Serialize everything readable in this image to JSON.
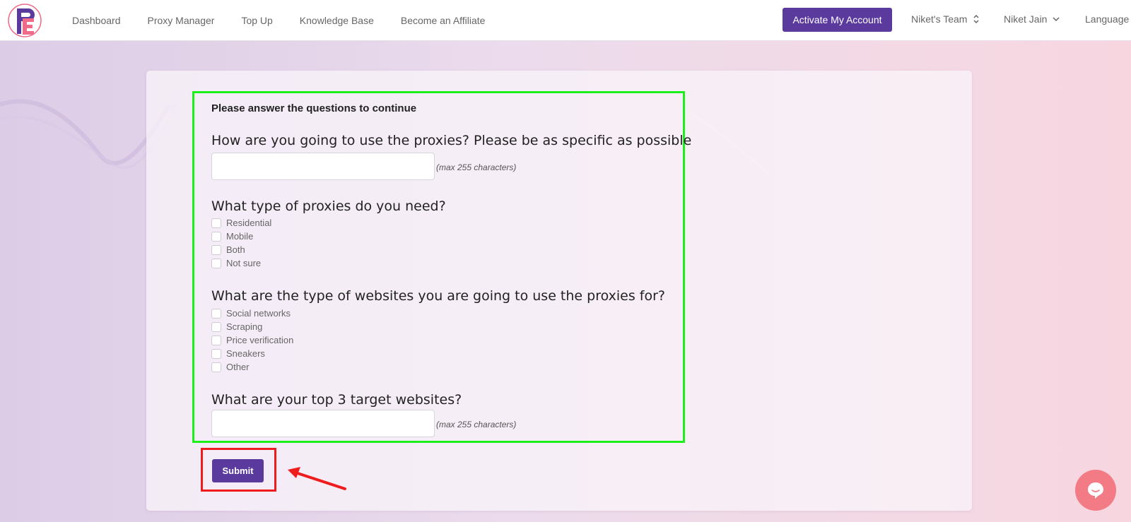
{
  "nav": {
    "links": [
      "Dashboard",
      "Proxy Manager",
      "Top Up",
      "Knowledge Base",
      "Become an Affiliate"
    ],
    "activate_label": "Activate My Account",
    "team_label": "Niket's Team",
    "user_label": "Niket Jain",
    "language_label": "Language"
  },
  "form": {
    "intro": "Please answer the questions to continue",
    "q1": {
      "title": "How are you going to use the proxies? Please be as specific as possible",
      "value": "",
      "hint": "(max 255 characters)"
    },
    "q2": {
      "title": "What type of proxies do you need?",
      "options": [
        "Residential",
        "Mobile",
        "Both",
        "Not sure"
      ]
    },
    "q3": {
      "title": "What are the type of websites you are going to use the proxies for?",
      "options": [
        "Social networks",
        "Scraping",
        "Price verification",
        "Sneakers",
        "Other"
      ]
    },
    "q4": {
      "title": "What are your top 3 target websites?",
      "value": "",
      "hint": "(max 255 characters)"
    },
    "submit_label": "Submit"
  },
  "colors": {
    "accent": "#5b3a9e",
    "highlight_green": "#1bf01b",
    "highlight_red": "#ee1c1c",
    "chat": "#f37b86",
    "logo_pink": "#f06b8a"
  },
  "icons": {
    "logo": "fe-logo-icon",
    "team_dropdown": "updown-chevron-icon",
    "user_dropdown": "chevron-down-icon",
    "chat": "chat-bubble-icon",
    "arrow": "red-arrow-icon"
  }
}
